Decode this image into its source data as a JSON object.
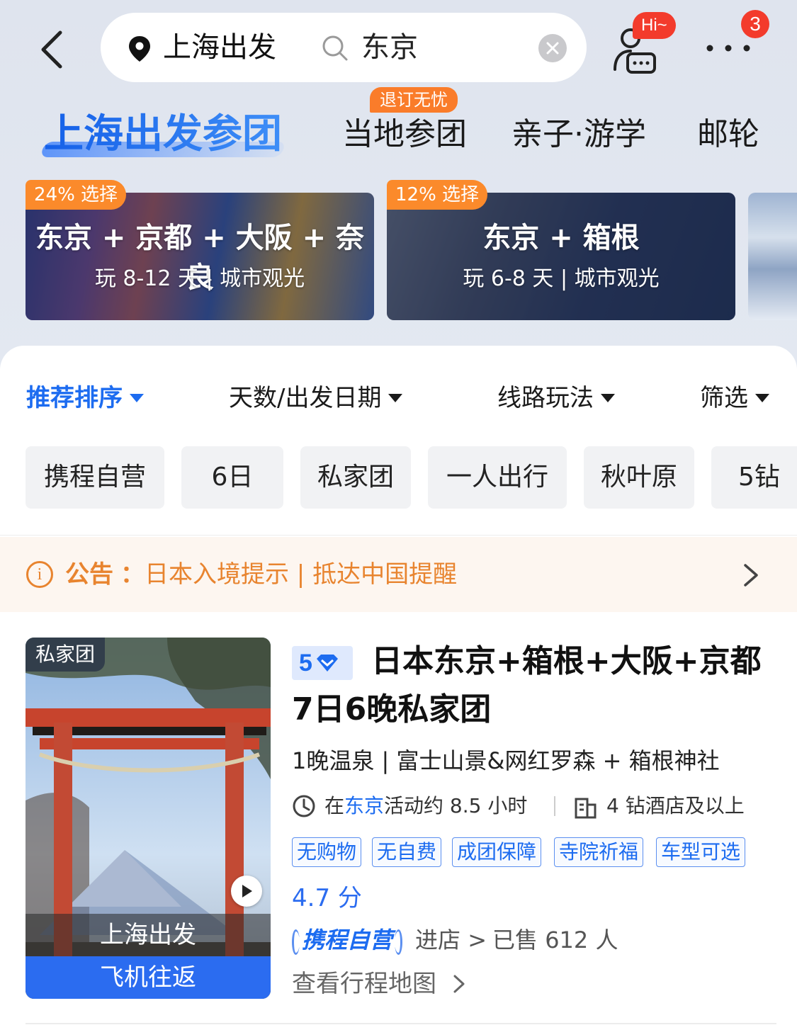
{
  "header": {
    "from_city": "上海出发",
    "search_value": "东京",
    "hi_badge": "Hi~",
    "more_badge_count": "3"
  },
  "tabs": [
    {
      "label": "上海出发参团",
      "active": true
    },
    {
      "label": "当地参团",
      "badge": "退订无忧"
    },
    {
      "label": "亲子·游学"
    },
    {
      "label": "邮轮"
    }
  ],
  "routes": [
    {
      "percent": "24% 选择",
      "title": "东京 + 京都 + 大阪 + 奈良",
      "subtitle": "玩 8-12 天 | 城市观光"
    },
    {
      "percent": "12% 选择",
      "title": "东京 + 箱根",
      "subtitle": "玩 6-8 天 | 城市观光"
    }
  ],
  "sort_bar": [
    {
      "label": "推荐排序",
      "active": true
    },
    {
      "label": "天数/出发日期"
    },
    {
      "label": "线路玩法"
    },
    {
      "label": "筛选"
    }
  ],
  "chips": [
    "携程自营",
    "6日",
    "私家团",
    "一人出行",
    "秋叶原",
    "5钻"
  ],
  "notice": {
    "label": "公告",
    "text": "日本入境提示 | 抵达中国提醒"
  },
  "product": {
    "thumb_tag": "私家团",
    "depart": "上海出发",
    "transport": "飞机往返",
    "level": "5",
    "title": "日本东京+箱根+大阪+京都7日6晚私家团",
    "subtitle": "1晚温泉 | 富士山景&网红罗森 + 箱根神社",
    "activity_prefix": "在",
    "activity_city": "东京",
    "activity_suffix": "活动约 8.5 小时",
    "hotel": "4 钻酒店及以上",
    "tags": [
      "无购物",
      "无自费",
      "成团保障",
      "寺院祈福",
      "车型可选"
    ],
    "score": "4.7 分",
    "shop": "携程自营",
    "enter": "进店",
    "sold": "已售 612 人",
    "map_link": "查看行程地图"
  },
  "colors": {
    "accent": "#1d6cf0",
    "badge_red": "#f33b2c",
    "badge_orange": "#fb8a2b",
    "notice_orange": "#e8842f"
  }
}
